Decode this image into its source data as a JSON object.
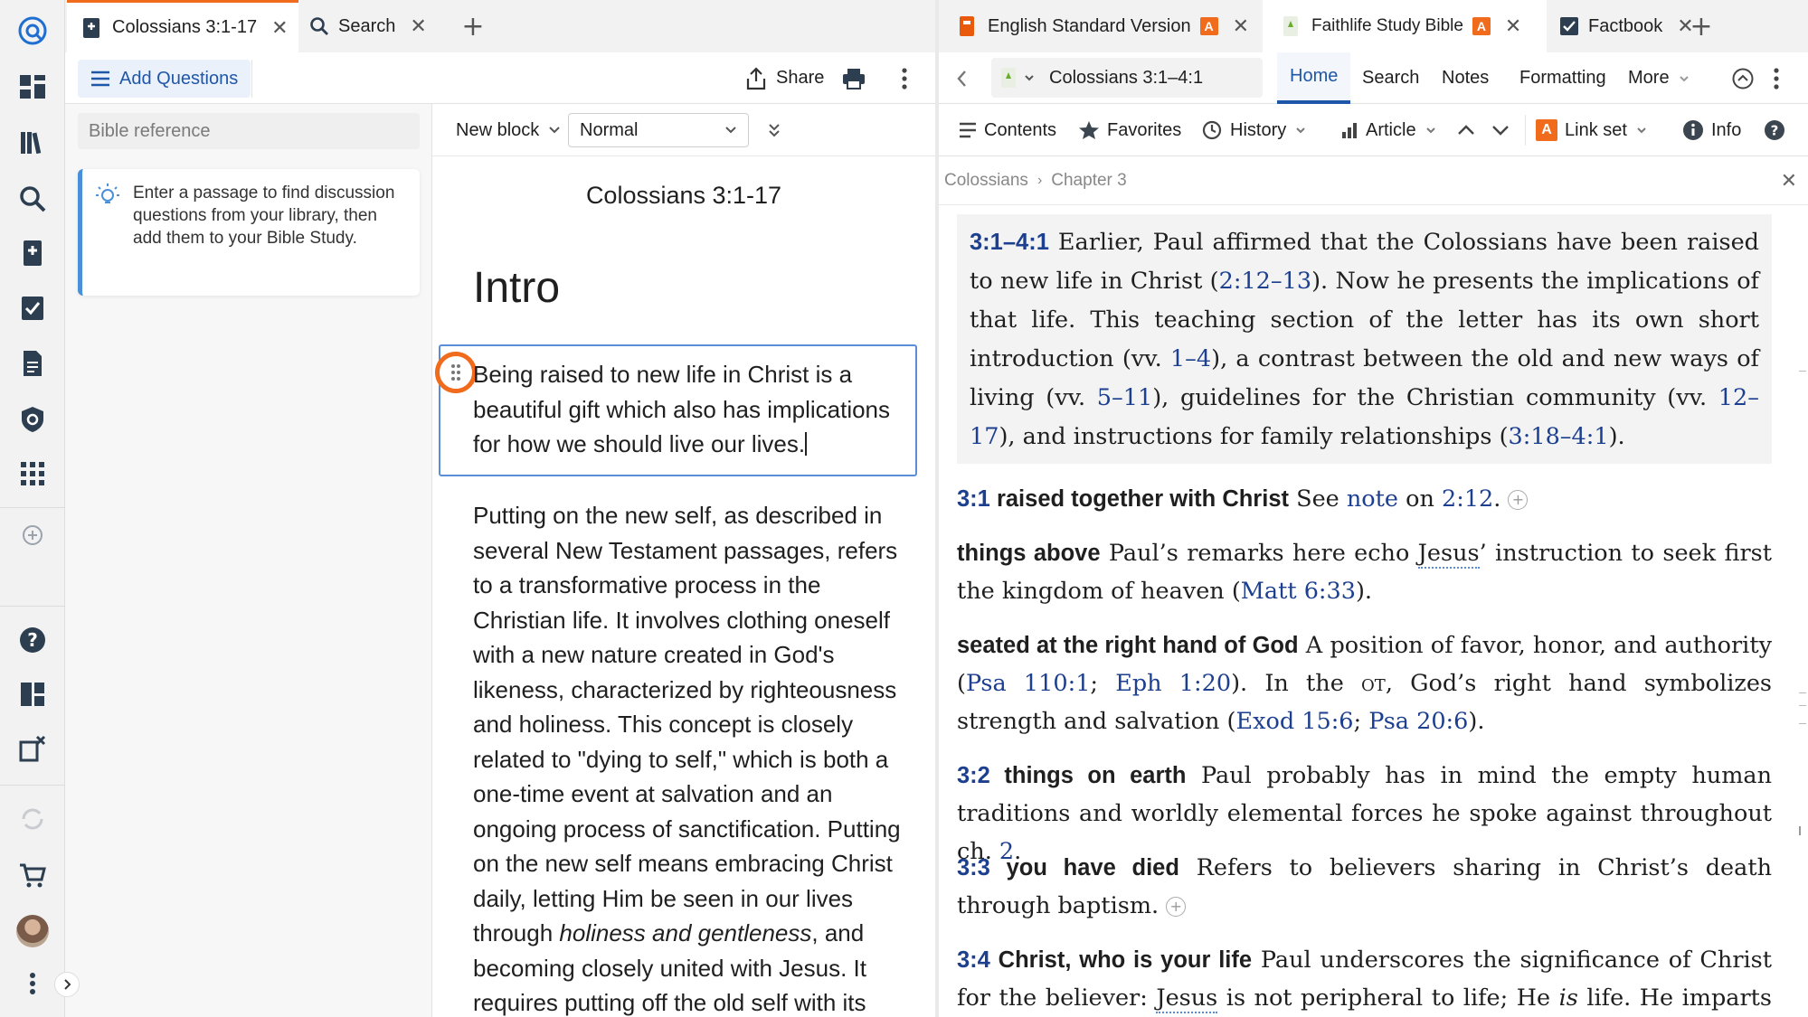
{
  "left_window": {
    "tabs": [
      {
        "label": "Colossians 3:1-17"
      },
      {
        "label": "Search"
      }
    ],
    "toolbar": {
      "add_questions": "Add Questions",
      "share": "Share"
    },
    "questions_pane": {
      "reference_placeholder": "Bible reference",
      "tip": "Enter a passage to find discussion questions from your library, then add them to your Bible Study."
    },
    "doc_toolbar": {
      "block_type": "New block",
      "style_value": "Normal"
    },
    "document": {
      "title": "Colossians 3:1-17",
      "heading": "Intro",
      "para1": "Being raised to new life in Christ is a beautiful gift which also has implications for how we should live our lives.",
      "para2_part1": "Putting on the new self, as described in several New Testament passages, refers to a transformative process in the Christian life. It involves clothing oneself with a new nature created in God's likeness, characterized by righteousness and holiness. This concept is closely related to \"dying to self,\" which is both a one-time event at salvation and an ongoing process of sanctification. Putting on the new self means embracing Christ daily, letting Him be seen in our lives through ",
      "para2_italic": "holiness and gentleness",
      "para2_part2": ", and becoming closely united with Jesus. It requires putting off the old self with its"
    }
  },
  "right_window": {
    "tabs": [
      {
        "label": "English Standard Version"
      },
      {
        "label": "Faithlife Study Bible"
      },
      {
        "label": "Factbook"
      }
    ],
    "nav": {
      "reference": "Colossians 3:1–4:1",
      "tabs": [
        "Home",
        "Search",
        "Notes",
        "Formatting",
        "More"
      ]
    },
    "secondary": {
      "contents": "Contents",
      "favorites": "Favorites",
      "history": "History",
      "article": "Article",
      "link_set": "Link set",
      "info": "Info"
    },
    "breadcrumb": [
      "Colossians",
      "Chapter 3"
    ],
    "badge_letter": "A",
    "notes": {
      "intro_ref": "3:1–4:1",
      "intro_t1": " Earlier, Paul affirmed that the Colossians have been raised to new life in Christ (",
      "intro_l1": "2:12–13",
      "intro_t2": "). Now he presents the implications of that life. This teaching section of the letter has its own short introduction (vv. ",
      "intro_l2": "1–4",
      "intro_t3": "), a contrast between the old and new ways of living (vv. ",
      "intro_l3": "5–11",
      "intro_t4": "), guidelines for the Christian community (vv. ",
      "intro_l4": "12–17",
      "intro_t5": "), and instructions for family relationships (",
      "intro_l5": "3:18–4:1",
      "intro_t6": ").",
      "n1_ref": "3:1",
      "n1_kw": " raised together with Christ",
      "n1_t1": " See ",
      "n1_l1": "note",
      "n1_t2": " on ",
      "n1_l2": "2:12",
      "n1_t3": ".",
      "n2_kw": "things above",
      "n2_t1": " Paul’s remarks here echo ",
      "n2_u": "Jesus",
      "n2_t2": "’ instruction to seek first the kingdom of heaven (",
      "n2_l1": "Matt 6:33",
      "n2_t3": ").",
      "n3_kw": "seated at the right hand of God",
      "n3_t1": " A position of favor, honor, and authority (",
      "n3_l1": "Psa 110:1",
      "n3_t2": "; ",
      "n3_l2": "Eph 1:20",
      "n3_t3": "). In the ",
      "n3_sc": "ot",
      "n3_t4": ", God’s right hand symbolizes strength and salvation (",
      "n3_l3": "Exod 15:6",
      "n3_t5": "; ",
      "n3_l4": "Psa 20:6",
      "n3_t6": ").",
      "n4_ref": "3:2",
      "n4_kw": " things on earth",
      "n4_t1": " Paul probably has in mind the empty human traditions and worldly elemental forces he spoke against throughout ch. ",
      "n4_l1": "2",
      "n4_t2": ".",
      "n5_ref": "3:3",
      "n5_kw": " you have died",
      "n5_t1": " Refers to believers sharing in Christ’s death through baptism.",
      "n6_ref": "3:4",
      "n6_kw": " Christ, who is your life",
      "n6_t1": " Paul underscores the significance of Christ for the believer: ",
      "n6_u": "Jesus",
      "n6_t2": " is not peripheral to life; He ",
      "n6_i": "is",
      "n6_t3": " life. He imparts God’s life,"
    }
  },
  "colors": {
    "accent_orange": "#f06b1b",
    "link_blue": "#1d3f8f",
    "tab_blue": "#1f57a8"
  }
}
